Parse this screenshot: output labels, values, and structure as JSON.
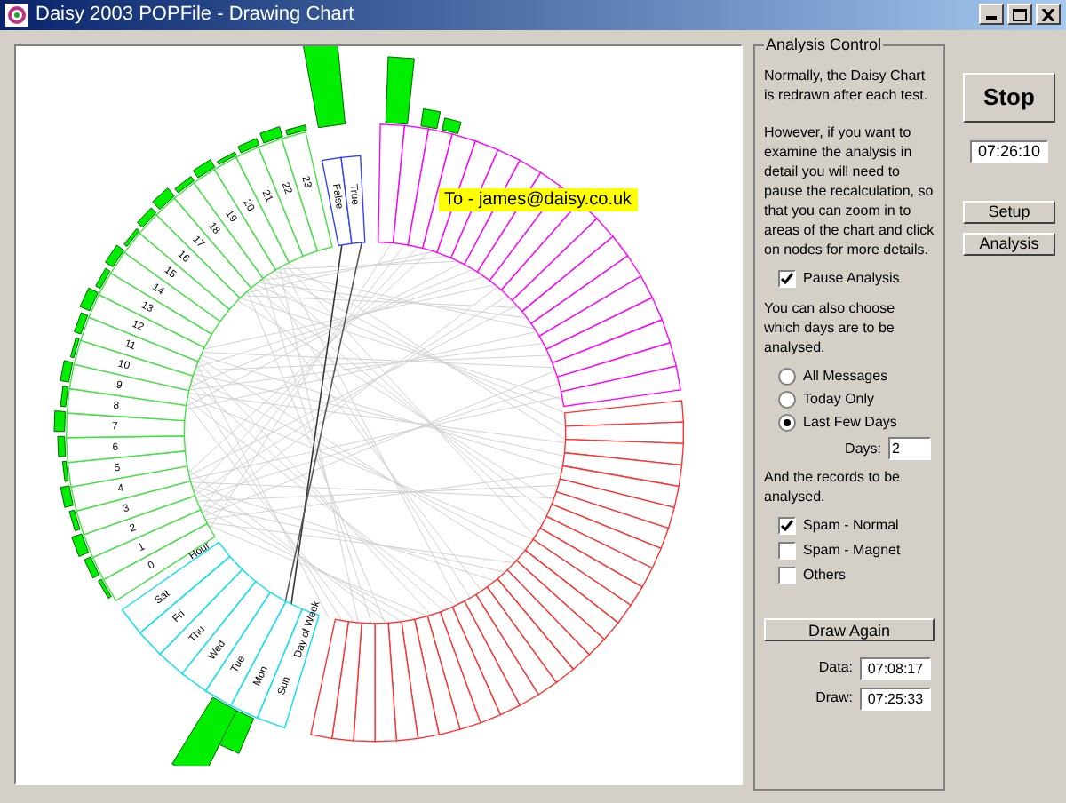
{
  "window": {
    "title": "Daisy 2003 POPFile - Drawing Chart"
  },
  "chart": {
    "tooltip": "To - james@daisy.co.uk",
    "hour_header": "Hour",
    "hour_labels": [
      "0",
      "1",
      "2",
      "3",
      "4",
      "5",
      "6",
      "7",
      "8",
      "9",
      "10",
      "11",
      "12",
      "13",
      "14",
      "15",
      "16",
      "17",
      "18",
      "19",
      "20",
      "21",
      "22",
      "23"
    ],
    "day_header": "Day of Week",
    "day_labels": [
      "Sun",
      "Mon",
      "Tue",
      "Wed",
      "Thu",
      "Fri",
      "Sat"
    ],
    "class_labels": [
      "False",
      "True"
    ]
  },
  "analysis_control": {
    "title": "Analysis Control",
    "intro": "Normally, the Daisy Chart is redrawn after each test.",
    "pause_text": "However, if you want to examine the analysis in detail you will need to pause the recalculation, so that you can zoom in to areas of the chart and click on nodes for more details.",
    "pause": {
      "label": "Pause Analysis",
      "checked": true
    },
    "days_text": "You can also choose which days are to be analysed.",
    "day_options": [
      {
        "label": "All Messages",
        "selected": false
      },
      {
        "label": "Today Only",
        "selected": false
      },
      {
        "label": "Last Few Days",
        "selected": true
      }
    ],
    "days": {
      "label": "Days:",
      "value": "2"
    },
    "records_text": "And the records to be analysed.",
    "records": [
      {
        "label": "Spam - Normal",
        "checked": true
      },
      {
        "label": "Spam - Magnet",
        "checked": false
      },
      {
        "label": "Others",
        "checked": false
      }
    ],
    "draw_again": "Draw Again",
    "data": {
      "label": "Data:",
      "value": "07:08:17"
    },
    "draw": {
      "label": "Draw:",
      "value": "07:25:33"
    }
  },
  "controls": {
    "stop": "Stop",
    "time": "07:26:10",
    "setup": "Setup",
    "analysis": "Analysis"
  }
}
